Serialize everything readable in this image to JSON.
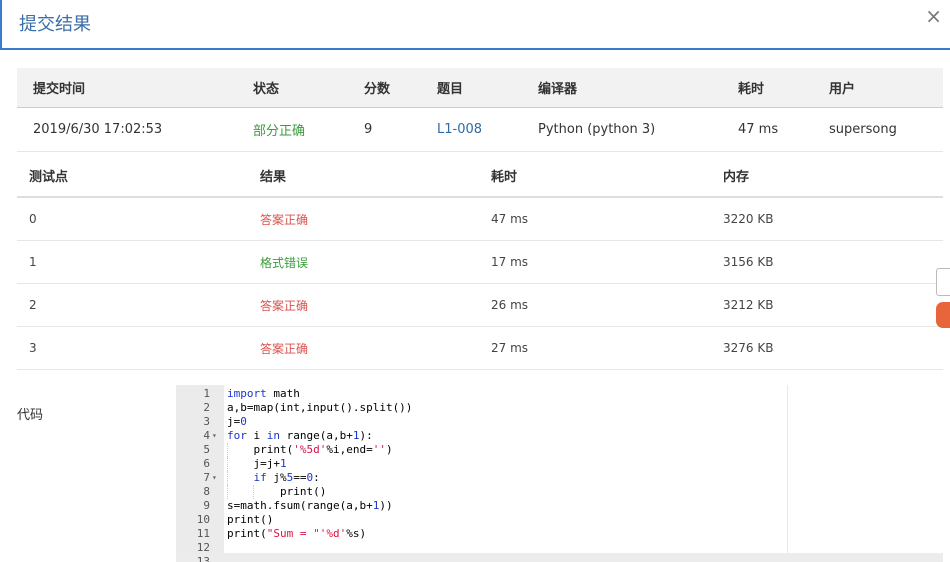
{
  "dialog": {
    "title": "提交结果",
    "close_label": "×"
  },
  "summary": {
    "headers": [
      "提交时间",
      "状态",
      "分数",
      "题目",
      "编译器",
      "耗时",
      "用户"
    ],
    "row": {
      "time": "2019/6/30 17:02:53",
      "status": "部分正确",
      "score": "9",
      "problem": "L1-008",
      "compiler": "Python (python 3)",
      "elapsed": "47 ms",
      "user": "supersong"
    }
  },
  "tests": {
    "headers": [
      "测试点",
      "结果",
      "耗时",
      "内存"
    ],
    "rows": [
      {
        "id": "0",
        "result": "答案正确",
        "time": "47 ms",
        "memory": "3220 KB",
        "color": "#d9534f"
      },
      {
        "id": "1",
        "result": "格式错误",
        "time": "17 ms",
        "memory": "3156 KB",
        "color": "#3a9d3a"
      },
      {
        "id": "2",
        "result": "答案正确",
        "time": "26 ms",
        "memory": "3212 KB",
        "color": "#d9534f"
      },
      {
        "id": "3",
        "result": "答案正确",
        "time": "27 ms",
        "memory": "3276 KB",
        "color": "#d9534f"
      }
    ]
  },
  "code": {
    "label": "代码",
    "lines": [
      {
        "n": "1",
        "text": "import math"
      },
      {
        "n": "2",
        "text": "a,b=map(int,input().split())"
      },
      {
        "n": "3",
        "text": "j=0"
      },
      {
        "n": "4",
        "text": "for i in range(a,b+1):",
        "fold": true
      },
      {
        "n": "5",
        "text": "    print('%5d'%i,end='')"
      },
      {
        "n": "6",
        "text": "    j=j+1"
      },
      {
        "n": "7",
        "text": "    if j%5==0:",
        "fold": true
      },
      {
        "n": "8",
        "text": "        print()"
      },
      {
        "n": "9",
        "text": "s=math.fsum(range(a,b+1))"
      },
      {
        "n": "10",
        "text": "print()"
      },
      {
        "n": "11",
        "text": "print(\"Sum = \"'%d'%s)"
      },
      {
        "n": "12",
        "text": ""
      },
      {
        "n": "13",
        "text": ""
      }
    ]
  }
}
